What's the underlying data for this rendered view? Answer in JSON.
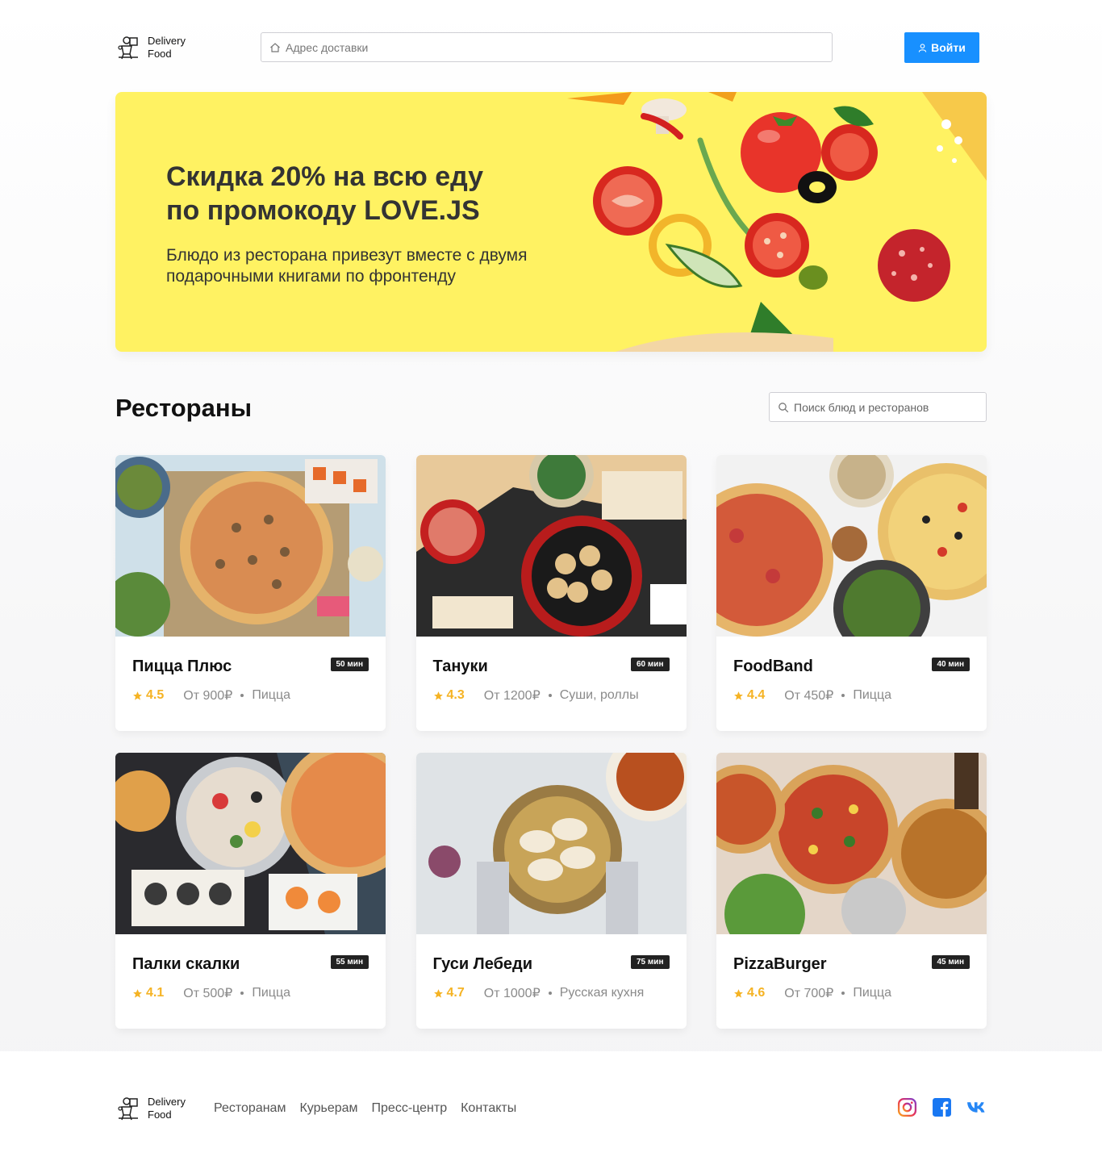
{
  "brand": {
    "line1": "Delivery",
    "line2": "Food"
  },
  "header": {
    "address_placeholder": "Адрес доставки",
    "login_label": "Войти"
  },
  "promo": {
    "title_line1": "Скидка 20% на всю еду",
    "title_line2": "по промокоду LOVE.JS",
    "text_line1": "Блюдо из ресторана привезут вместе с двумя",
    "text_line2": "подарочными книгами по фронтенду"
  },
  "restaurants": {
    "title": "Рестораны",
    "search_placeholder": "Поиск блюд и ресторанов",
    "cards": [
      {
        "name": "Пицца Плюс",
        "time": "50 мин",
        "rating": "4.5",
        "price": "От 900₽",
        "category": "Пицца"
      },
      {
        "name": "Тануки",
        "time": "60 мин",
        "rating": "4.3",
        "price": "От 1200₽",
        "category": "Суши, роллы"
      },
      {
        "name": "FoodBand",
        "time": "40 мин",
        "rating": "4.4",
        "price": "От 450₽",
        "category": "Пицца"
      },
      {
        "name": "Палки скалки",
        "time": "55 мин",
        "rating": "4.1",
        "price": "От 500₽",
        "category": "Пицца"
      },
      {
        "name": "Гуси Лебеди",
        "time": "75 мин",
        "rating": "4.7",
        "price": "От 1000₽",
        "category": "Русская кухня"
      },
      {
        "name": "PizzaBurger",
        "time": "45 мин",
        "rating": "4.6",
        "price": "От 700₽",
        "category": "Пицца"
      }
    ]
  },
  "footer": {
    "nav": [
      "Ресторанам",
      "Курьерам",
      "Пресс-центр",
      "Контакты"
    ],
    "socials": [
      "instagram-icon",
      "facebook-icon",
      "vk-icon"
    ]
  },
  "colors": {
    "accent": "#1890ff",
    "promo_bg": "#fff262",
    "rating": "#f5b324"
  }
}
